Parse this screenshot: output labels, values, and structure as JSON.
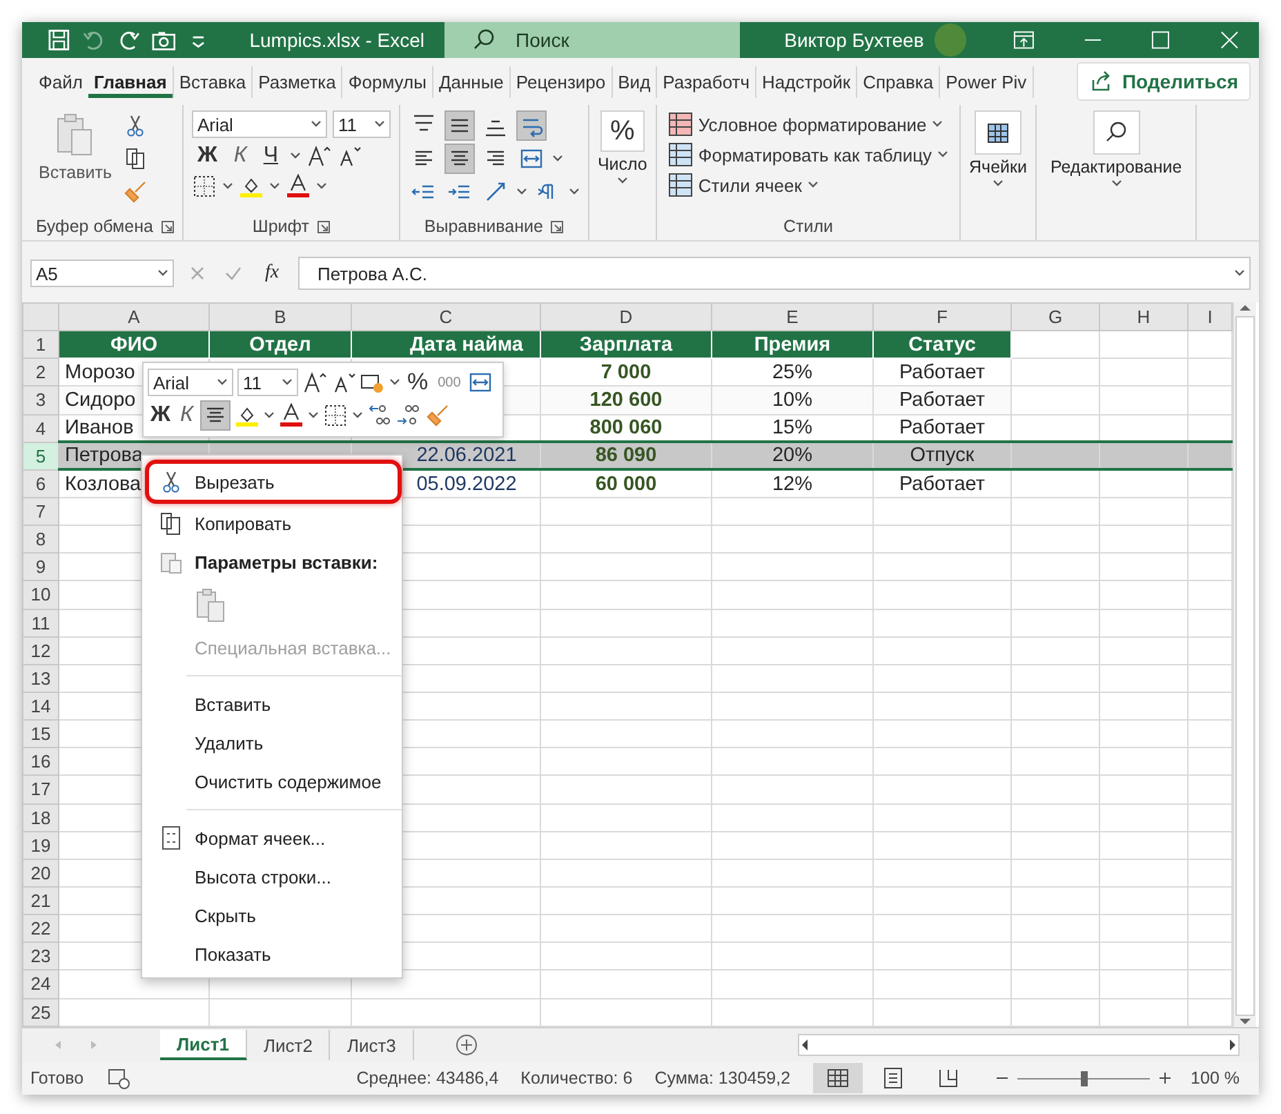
{
  "window": {
    "title": "Lumpics.xlsx  -  Excel",
    "user": "Виктор Бухтеев"
  },
  "quick_access": [
    {
      "kind": "save",
      "disabled": false
    },
    {
      "kind": "undo",
      "disabled": true
    },
    {
      "kind": "redo",
      "disabled": false
    },
    {
      "kind": "camera",
      "disabled": false
    },
    {
      "kind": "customize",
      "disabled": false
    }
  ],
  "search": {
    "placeholder": "Поиск"
  },
  "ribbon_tabs": [
    {
      "label": "Файл",
      "selected": false
    },
    {
      "label": "Главная",
      "selected": true
    },
    {
      "label": "Вставка",
      "selected": false
    },
    {
      "label": "Разметка",
      "selected": false
    },
    {
      "label": "Формулы",
      "selected": false
    },
    {
      "label": "Данные",
      "selected": false
    },
    {
      "label": "Рецензиро",
      "selected": false
    },
    {
      "label": "Вид",
      "selected": false
    },
    {
      "label": "Разработч",
      "selected": false
    },
    {
      "label": "Надстройк",
      "selected": false
    },
    {
      "label": "Справка",
      "selected": false
    },
    {
      "label": "Power Piv",
      "selected": false
    }
  ],
  "share_button": "Поделиться",
  "ribbon": {
    "clipboard": {
      "label": "Буфер обмена",
      "paste": "Вставить"
    },
    "font": {
      "label": "Шрифт",
      "font_name": "Arial",
      "font_size": "11",
      "bold": "Ж",
      "italic": "К",
      "underline": "Ч"
    },
    "alignment": {
      "label": "Выравнивание",
      "buttons": [
        {
          "kind": "top",
          "selected": false
        },
        {
          "kind": "middle",
          "selected": true
        },
        {
          "kind": "bottom",
          "selected": false
        },
        {
          "kind": "wrap",
          "selected": true
        },
        {
          "kind": "left",
          "selected": false
        },
        {
          "kind": "center",
          "selected": true
        },
        {
          "kind": "right",
          "selected": false
        },
        {
          "kind": "merge",
          "selected": false
        },
        {
          "kind": "outdent",
          "selected": false
        },
        {
          "kind": "indent",
          "selected": false
        },
        {
          "kind": "orientation",
          "selected": false
        },
        {
          "kind": "direction",
          "selected": false
        }
      ]
    },
    "number": {
      "label": "Число",
      "symbol": "%"
    },
    "styles": {
      "label": "Стили",
      "items": [
        "Условное форматирование",
        "Форматировать как таблицу",
        "Стили ячеек"
      ]
    },
    "cells": {
      "label": "Ячейки"
    },
    "editing": {
      "label": "Редактирование"
    }
  },
  "formula_bar": {
    "name_box": "A5",
    "function_symbol": "fx",
    "value": "Петрова А.С."
  },
  "sheet": {
    "columns": [
      "A",
      "B",
      "C",
      "D",
      "E",
      "F",
      "G",
      "H",
      "I"
    ],
    "rows": [
      {
        "number": "1",
        "kind": "header",
        "selected": false,
        "cells": [
          "ФИО",
          "Отдел",
          "Дата найма",
          "Зарплата",
          "Премия",
          "Статус"
        ]
      },
      {
        "number": "2",
        "kind": "data",
        "selected": false,
        "cells": [
          "Морозо",
          null,
          null,
          "7 000",
          "25%",
          "Работает"
        ]
      },
      {
        "number": "3",
        "kind": "data",
        "selected": false,
        "cells": [
          "Сидоро",
          null,
          null,
          "120 600",
          "10%",
          "Работает"
        ]
      },
      {
        "number": "4",
        "kind": "data",
        "selected": false,
        "cells": [
          "Иванов",
          null,
          null,
          "800 060",
          "15%",
          "Работает"
        ]
      },
      {
        "number": "5",
        "kind": "data",
        "selected": true,
        "cells": [
          "Петрова",
          null,
          "22.06.2021",
          "86 090",
          "20%",
          "Отпуск"
        ]
      },
      {
        "number": "6",
        "kind": "data",
        "selected": false,
        "cells": [
          "Козлова",
          null,
          "05.09.2022",
          "60 000",
          "12%",
          "Работает"
        ]
      },
      {
        "number": "7",
        "kind": "empty",
        "selected": false,
        "cells": []
      },
      {
        "number": "8",
        "kind": "empty",
        "selected": false,
        "cells": []
      },
      {
        "number": "9",
        "kind": "empty",
        "selected": false,
        "cells": []
      },
      {
        "number": "10",
        "kind": "empty",
        "selected": false,
        "cells": []
      },
      {
        "number": "11",
        "kind": "empty",
        "selected": false,
        "cells": []
      },
      {
        "number": "12",
        "kind": "empty",
        "selected": false,
        "cells": []
      },
      {
        "number": "13",
        "kind": "empty",
        "selected": false,
        "cells": []
      },
      {
        "number": "14",
        "kind": "empty",
        "selected": false,
        "cells": []
      },
      {
        "number": "15",
        "kind": "empty",
        "selected": false,
        "cells": []
      },
      {
        "number": "16",
        "kind": "empty",
        "selected": false,
        "cells": []
      },
      {
        "number": "17",
        "kind": "empty",
        "selected": false,
        "cells": []
      },
      {
        "number": "18",
        "kind": "empty",
        "selected": false,
        "cells": []
      },
      {
        "number": "19",
        "kind": "empty",
        "selected": false,
        "cells": []
      },
      {
        "number": "20",
        "kind": "empty",
        "selected": false,
        "cells": []
      },
      {
        "number": "21",
        "kind": "empty",
        "selected": false,
        "cells": []
      },
      {
        "number": "22",
        "kind": "empty",
        "selected": false,
        "cells": []
      },
      {
        "number": "23",
        "kind": "empty",
        "selected": false,
        "cells": []
      },
      {
        "number": "24",
        "kind": "empty",
        "selected": false,
        "cells": []
      },
      {
        "number": "25",
        "kind": "empty",
        "selected": false,
        "cells": []
      }
    ]
  },
  "mini_toolbar": {
    "font_name": "Arial",
    "font_size": "11",
    "percent": "%",
    "thousands": "000",
    "bold": "Ж",
    "italic": "К",
    "center_selected": true
  },
  "context_menu": [
    {
      "kind": "cut",
      "label": "Вырезать",
      "disabled": false,
      "highlighted": true
    },
    {
      "kind": "copy",
      "label": "Копировать",
      "disabled": false,
      "highlighted": false
    },
    {
      "kind": "paste-header",
      "label": "Параметры вставки:",
      "disabled": false,
      "highlighted": false
    },
    {
      "kind": "paste-option"
    },
    {
      "kind": "plain",
      "label": "Специальная вставка...",
      "disabled": true,
      "highlighted": false
    },
    {
      "kind": "separator"
    },
    {
      "kind": "plain",
      "label": "Вставить",
      "disabled": false,
      "highlighted": false
    },
    {
      "kind": "plain",
      "label": "Удалить",
      "disabled": false,
      "highlighted": false
    },
    {
      "kind": "plain",
      "label": "Очистить содержимое",
      "disabled": false,
      "highlighted": false
    },
    {
      "kind": "separator"
    },
    {
      "kind": "format",
      "label": "Формат ячеек...",
      "disabled": false,
      "highlighted": false
    },
    {
      "kind": "plain",
      "label": "Высота строки...",
      "disabled": false,
      "highlighted": false
    },
    {
      "kind": "plain",
      "label": "Скрыть",
      "disabled": false,
      "highlighted": false
    },
    {
      "kind": "plain",
      "label": "Показать",
      "disabled": false,
      "highlighted": false
    }
  ],
  "sheet_tabs": [
    {
      "label": "Лист1",
      "selected": true
    },
    {
      "label": "Лист2",
      "selected": false
    },
    {
      "label": "Лист3",
      "selected": false
    }
  ],
  "status_bar": {
    "mode": "Готово",
    "average": "Среднее: 43486,4",
    "count": "Количество: 6",
    "sum": "Сумма: 130459,2",
    "views": [
      {
        "kind": "normal",
        "selected": true
      },
      {
        "kind": "page-layout",
        "selected": false
      },
      {
        "kind": "page-break",
        "selected": false
      }
    ],
    "zoom": {
      "level": 0.5,
      "reading": "100 %"
    }
  }
}
